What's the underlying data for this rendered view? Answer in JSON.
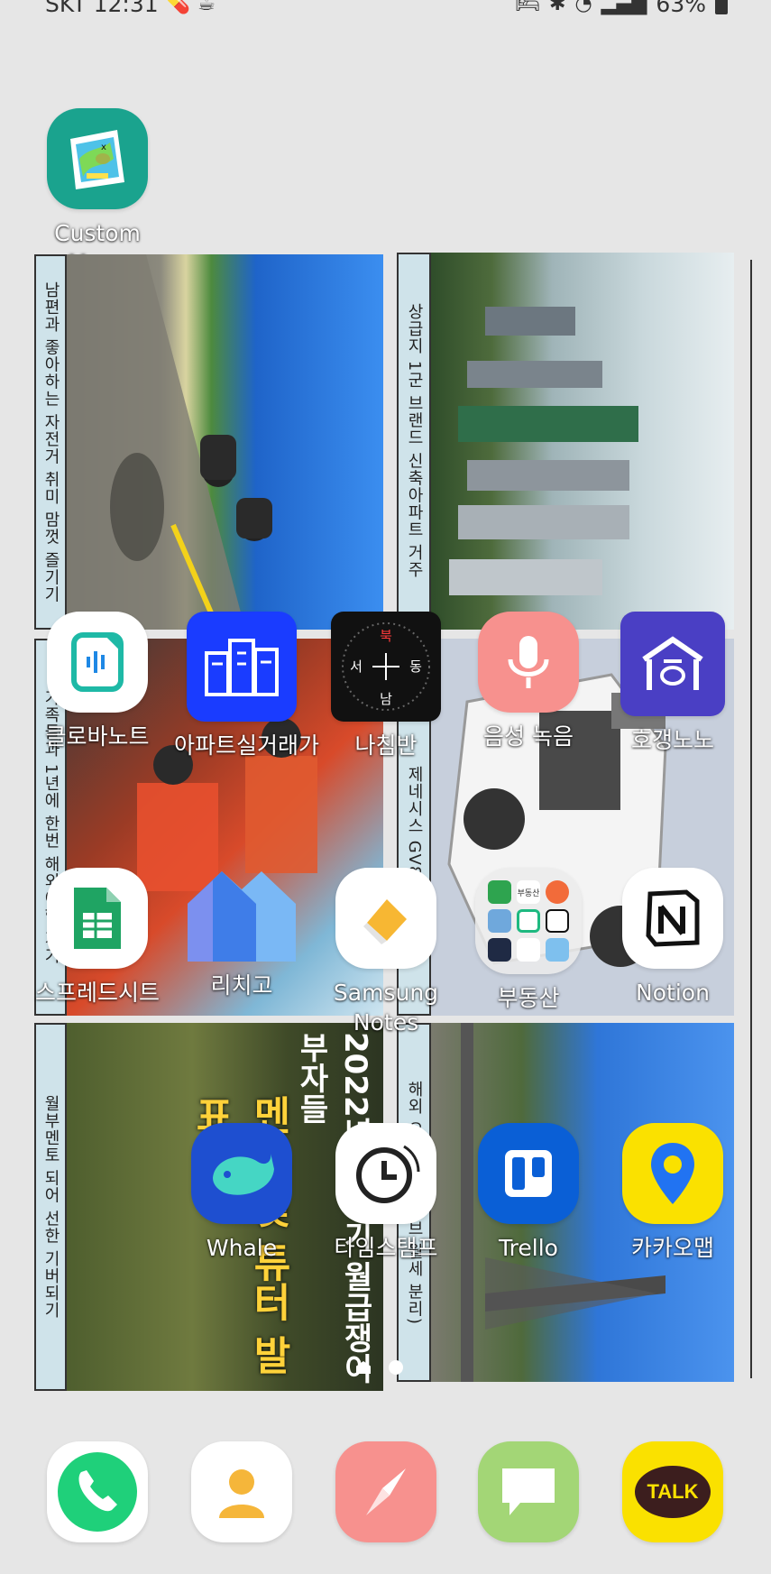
{
  "status_bar": {
    "carrier": "SKT",
    "time": "12:31",
    "battery": "63%"
  },
  "apps": {
    "custom_maps": "Custom Maps",
    "clova_note": "클로바노트",
    "apartment_price": "아파트실거래가",
    "compass": "나침반",
    "voice_recorder": "음성 녹음",
    "hogangnono": "호갱노노",
    "sheets": "스프레드시트",
    "richgo": "리치고",
    "samsung_notes": "Samsung Notes",
    "real_estate_folder": "부동산",
    "notion": "Notion",
    "whale": "Whale",
    "timestamp": "타임스탬프",
    "trello": "Trello",
    "kakaomap": "카카오맵"
  },
  "compass_letters": {
    "n": "북",
    "s": "남",
    "e": "동",
    "w": "서"
  },
  "widgets": {
    "cycling_caption": "남편과 좋아하는 자전거 취미 맘껏 즐기기",
    "apartment_caption": "상급지 1군 브랜드 신축아파트 거주",
    "family_caption": "가족들과 1년에 한번 해외여행 가기",
    "car_caption": "제네시스 GV80",
    "mentor_caption": "월부멘토 되어 선한 기버되기",
    "paris_caption": "해외 오두막 (유튜브 월세 분리)",
    "poster_title": "2022년 상반기 월급쟁이부자들",
    "poster_highlight": "멘토 및 튜터 발표"
  },
  "folder_mini": {
    "realestate_tag": "부동산"
  },
  "kakao_talk_label": "TALK",
  "colors": {
    "background": "#e6e6e6",
    "caption_bg": "#cfe3ea",
    "naver_blue": "#1a3cff",
    "voice_pink": "#f7918e",
    "hogang_purple": "#4a3fc4",
    "kakao_yellow": "#fae100",
    "phone_green": "#1fd07a",
    "messages_green": "#a3d676",
    "trello_blue": "#0a5fd6"
  }
}
